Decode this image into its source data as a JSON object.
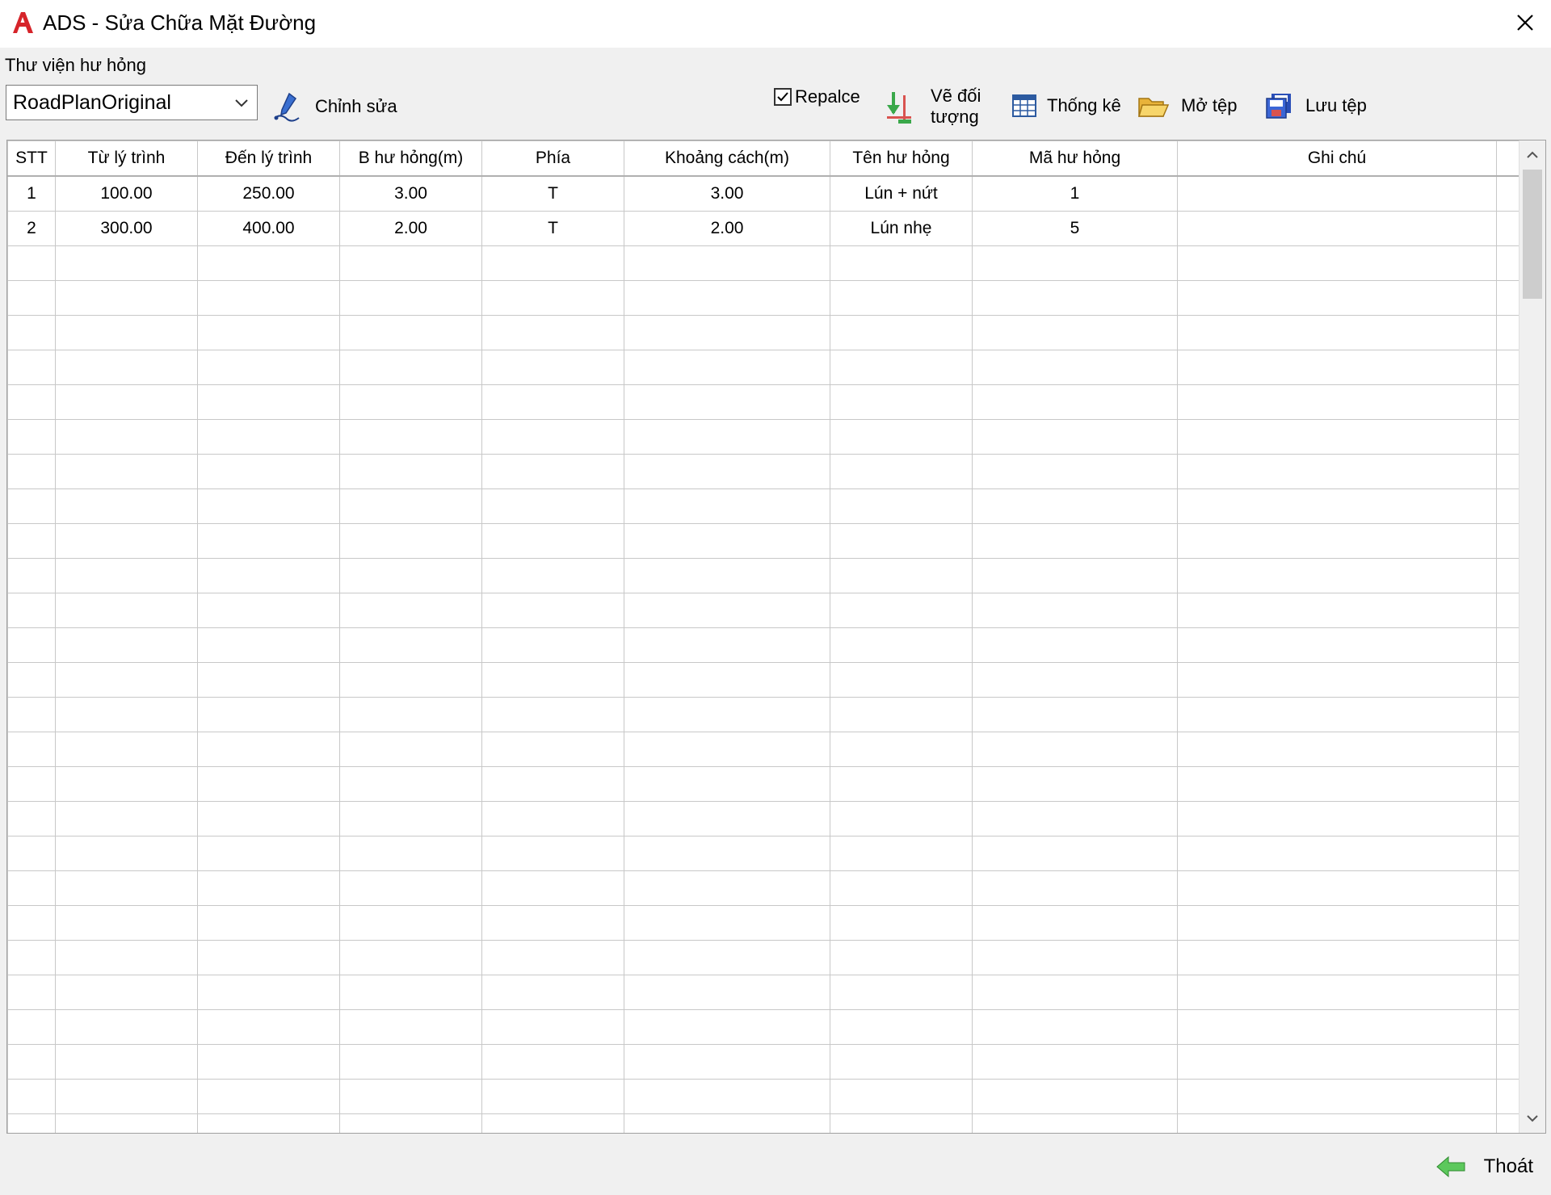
{
  "window": {
    "title": "ADS - Sửa Chữa Mặt Đường"
  },
  "library": {
    "label": "Thư viện hư hỏng",
    "selected": "RoadPlanOriginal"
  },
  "toolbar": {
    "edit": "Chỉnh sửa",
    "replace_label": "Repalce",
    "replace_checked": true,
    "draw_line1": "Vẽ đối",
    "draw_line2": "tượng",
    "stats": "Thống kê",
    "open": "Mở tệp",
    "save": "Lưu tệp"
  },
  "table": {
    "columns": [
      "STT",
      "Từ lý trình",
      "Đến lý trình",
      "B hư hỏng(m)",
      "Phía",
      "Khoảng cách(m)",
      "Tên hư hỏng",
      "Mã hư hỏng",
      "Ghi chú"
    ],
    "rows": [
      [
        "1",
        "100.00",
        "250.00",
        "3.00",
        "T",
        "3.00",
        "Lún + nứt",
        "1",
        ""
      ],
      [
        "2",
        "300.00",
        "400.00",
        "2.00",
        "T",
        "2.00",
        "Lún nhẹ",
        "5",
        ""
      ]
    ]
  },
  "footer": {
    "exit": "Thoát"
  }
}
